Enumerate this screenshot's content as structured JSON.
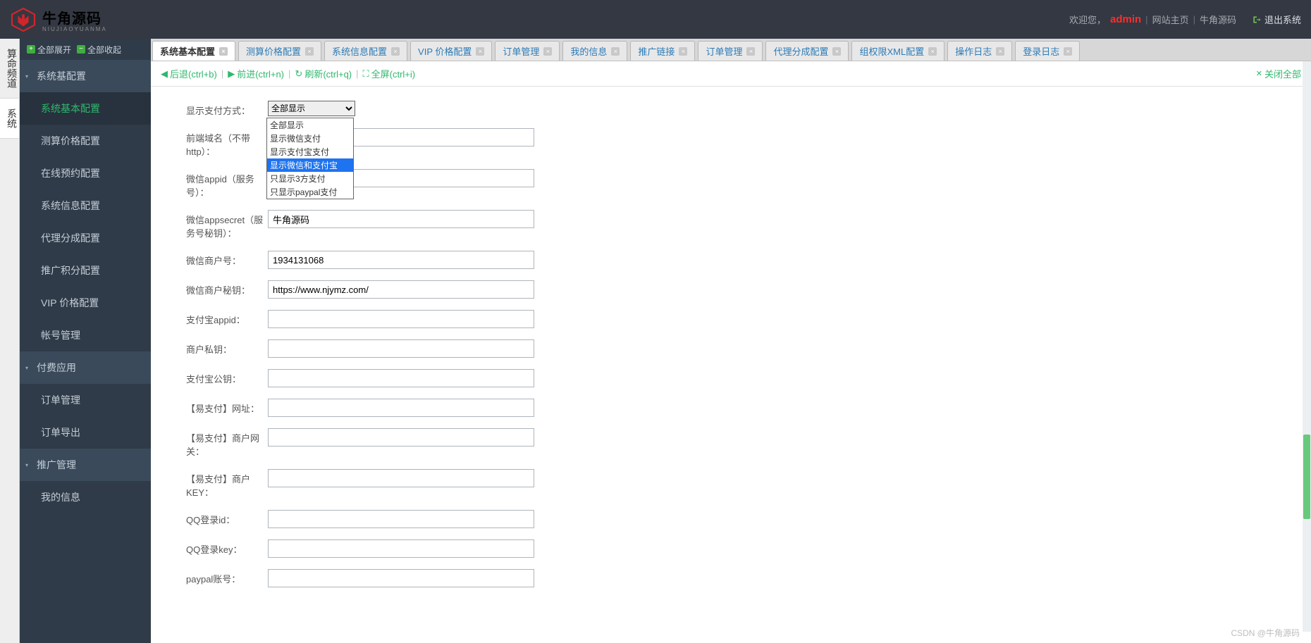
{
  "header": {
    "brand_text": "牛角源码",
    "brand_sub": "NIUJIAOYUANMA",
    "welcome": "欢迎您，",
    "user": "admin",
    "link_home": "网站主页",
    "link_brand": "牛角源码",
    "exit": "退出系统"
  },
  "col_nav": [
    {
      "label": "算命频道"
    },
    {
      "label": "系统"
    }
  ],
  "side_actions": {
    "expand": "全部展开",
    "collapse": "全部收起"
  },
  "sidebar": [
    {
      "type": "group",
      "label": "系统基配置"
    },
    {
      "type": "sub",
      "label": "系统基本配置",
      "active": true
    },
    {
      "type": "sub",
      "label": "测算价格配置"
    },
    {
      "type": "sub",
      "label": "在线预约配置"
    },
    {
      "type": "sub",
      "label": "系统信息配置"
    },
    {
      "type": "sub",
      "label": "代理分成配置"
    },
    {
      "type": "sub",
      "label": "推广积分配置"
    },
    {
      "type": "sub",
      "label": "VIP 价格配置"
    },
    {
      "type": "sub",
      "label": "帐号管理"
    },
    {
      "type": "group",
      "label": "付费应用"
    },
    {
      "type": "sub",
      "label": "订单管理"
    },
    {
      "type": "sub",
      "label": "订单导出"
    },
    {
      "type": "group",
      "label": "推广管理"
    },
    {
      "type": "sub",
      "label": "我的信息"
    }
  ],
  "tabs": [
    {
      "label": "系统基本配置",
      "active": true
    },
    {
      "label": "测算价格配置"
    },
    {
      "label": "系统信息配置"
    },
    {
      "label": "VIP 价格配置"
    },
    {
      "label": "订单管理"
    },
    {
      "label": "我的信息"
    },
    {
      "label": "推广链接"
    },
    {
      "label": "订单管理"
    },
    {
      "label": "代理分成配置"
    },
    {
      "label": "组权限XML配置"
    },
    {
      "label": "操作日志"
    },
    {
      "label": "登录日志"
    }
  ],
  "toolbar": {
    "back": "后退(ctrl+b)",
    "forward": "前进(ctrl+n)",
    "refresh": "刷新(ctrl+q)",
    "fullscreen": "全屏(ctrl+i)",
    "close_all": "关闭全部"
  },
  "form": {
    "pay_method_label": "显示支付方式：",
    "pay_method_value": "全部显示",
    "pay_method_options": [
      "全部显示",
      "显示微信支付",
      "显示支付宝支付",
      "显示微信和支付宝",
      "只显示3方支付",
      "只显示paypal支付"
    ],
    "domain_label": "前端域名（不带http）：",
    "domain_value": "",
    "appid_label": "微信appid（服务号）：",
    "appid_value": "",
    "secret_label": "微信appsecret（服务号秘钥）：",
    "secret_value": "牛角源码",
    "mch_label": "微信商户号：",
    "mch_value": "1934131068",
    "mchkey_label": "微信商户秘钥：",
    "mchkey_value": "https://www.njymz.com/",
    "ali_appid_label": "支付宝appid：",
    "ali_appid_value": "",
    "mch_priv_label": "商户私钥：",
    "mch_priv_value": "",
    "ali_pub_label": "支付宝公钥：",
    "ali_pub_value": "",
    "ezf_url_label": "【易支付】网址：",
    "ezf_url_value": "",
    "ezf_gw_label": "【易支付】商户网关：",
    "ezf_gw_value": "",
    "ezf_key_label": "【易支付】商户KEY：",
    "ezf_key_value": "",
    "qqid_label": "QQ登录id：",
    "qqid_value": "",
    "qqkey_label": "QQ登录key：",
    "qqkey_value": "",
    "paypal_label": "paypal账号：",
    "paypal_value": ""
  },
  "watermark": "CSDN @牛角源码"
}
